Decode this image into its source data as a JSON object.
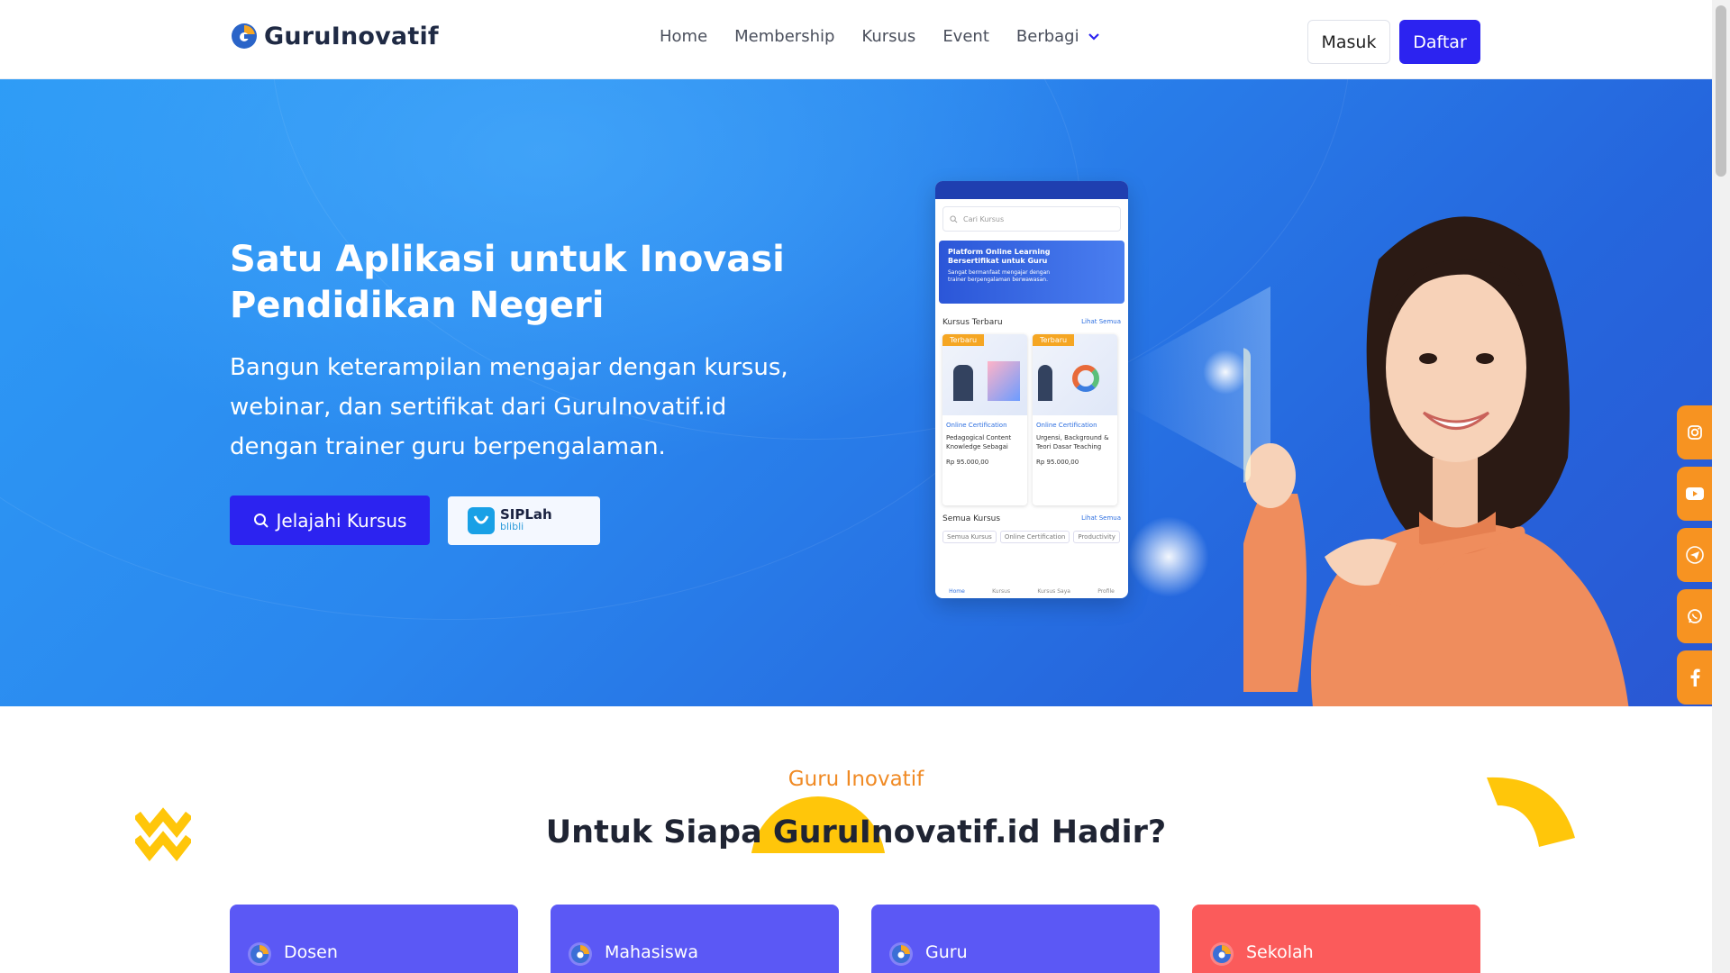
{
  "brand": {
    "name": "GuruInovatif"
  },
  "nav": {
    "links": [
      "Home",
      "Membership",
      "Kursus",
      "Event",
      "Berbagi"
    ],
    "login_label": "Masuk",
    "register_label": "Daftar"
  },
  "hero": {
    "title": "Satu Aplikasi untuk Inovasi Pendidikan Negeri",
    "subtitle": "Bangun keterampilan mengajar dengan kursus, webinar, dan sertifikat dari GuruInovatif.id dengan trainer guru berpengalaman.",
    "cta_label": "Jelajahi Kursus",
    "partner": {
      "name": "SIPLah",
      "sub": "blibli"
    }
  },
  "phone": {
    "search_placeholder": "Cari Kursus",
    "banner_title": "Platform Online Learning Bersertifikat untuk Guru",
    "banner_text": "Sangat bermanfaat mengajar dengan trainer berpengalaman berwawasan.",
    "section_latest": "Kursus Terbaru",
    "see_all": "Lihat Semua",
    "cards": [
      {
        "badge": "Terbaru",
        "type": "Online Certification",
        "title": "Pedagogical Content Knowledge Sebagai",
        "price": "Rp 95.000,00"
      },
      {
        "badge": "Terbaru",
        "type": "Online Certification",
        "title": "Urgensi, Background & Teori Dasar Teaching",
        "price": "Rp 95.000,00"
      }
    ],
    "section_all": "Semua Kursus",
    "tabs": [
      "Semua Kursus",
      "Online Certification",
      "Productivity"
    ],
    "bottom_nav": [
      "Home",
      "Kursus",
      "Kursus Saya",
      "Profile"
    ]
  },
  "social": {
    "icons": [
      "instagram-icon",
      "youtube-icon",
      "telegram-icon",
      "whatsapp-icon",
      "facebook-icon"
    ],
    "color": "#f79321"
  },
  "section": {
    "label": "Guru Inovatif",
    "title": "Untuk Siapa GuruInovatif.id Hadir?"
  },
  "audience_cards": [
    {
      "label": "Dosen",
      "color": "#5b58f5"
    },
    {
      "label": "Mahasiswa",
      "color": "#5b58f5"
    },
    {
      "label": "Guru",
      "color": "#5b58f5"
    },
    {
      "label": "Sekolah",
      "color": "#fb5b5b"
    }
  ],
  "colors": {
    "primary": "#2c23f0",
    "accent": "#f08a24",
    "yellow": "#ffc60a"
  }
}
